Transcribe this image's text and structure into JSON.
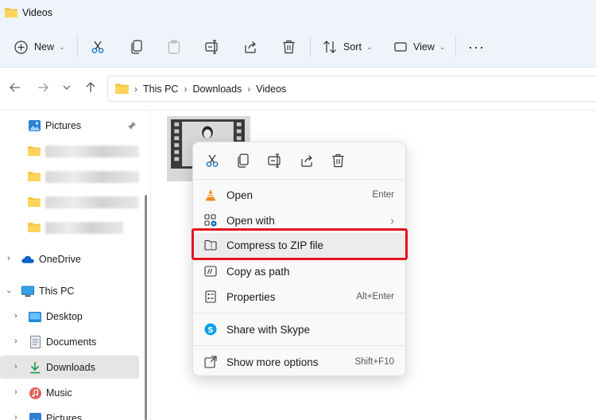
{
  "window": {
    "title": "Videos"
  },
  "toolbar": {
    "new_label": "New",
    "sort_label": "Sort",
    "view_label": "View",
    "more_label": "···"
  },
  "breadcrumb": [
    "This PC",
    "Downloads",
    "Videos"
  ],
  "sidebar": {
    "pictures_top": "Pictures",
    "onedrive": "OneDrive",
    "thispc": "This PC",
    "desktop": "Desktop",
    "documents": "Documents",
    "downloads": "Downloads",
    "music": "Music",
    "pictures_bottom": "Pictures"
  },
  "context_menu": {
    "open": {
      "label": "Open",
      "shortcut": "Enter"
    },
    "open_with": {
      "label": "Open with"
    },
    "compress": {
      "label": "Compress to ZIP file"
    },
    "copy_path": {
      "label": "Copy as path"
    },
    "properties": {
      "label": "Properties",
      "shortcut": "Alt+Enter"
    },
    "skype": {
      "label": "Share with Skype"
    },
    "more": {
      "label": "Show more options",
      "shortcut": "Shift+F10"
    }
  },
  "colors": {
    "accent": "#0067c0",
    "highlight_box": "#e3131e",
    "folder": "#f4c542",
    "chrome_bg": "#eef4f9"
  }
}
